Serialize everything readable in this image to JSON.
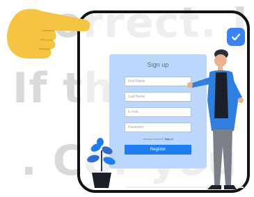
{
  "background_text": [
    "correct. I",
    "If the",
    ". Cor you"
  ],
  "signup": {
    "title": "Sign up",
    "first_name_placeholder": "First Name",
    "last_name_placeholder": "Last Name",
    "email_placeholder": "E-mail",
    "password_placeholder": "Password",
    "signin_prompt": "Already a member?",
    "signin_link": "Sign In",
    "register_label": "Register"
  },
  "icons": {
    "hand": "pointing-hand-icon",
    "badge": "check-badge-icon",
    "plant": "potted-plant-icon",
    "person": "person-illustration"
  },
  "colors": {
    "accent": "#1f7df0",
    "card": "#bcd7fb",
    "hand": "#f6c443",
    "frame": "#111111"
  }
}
